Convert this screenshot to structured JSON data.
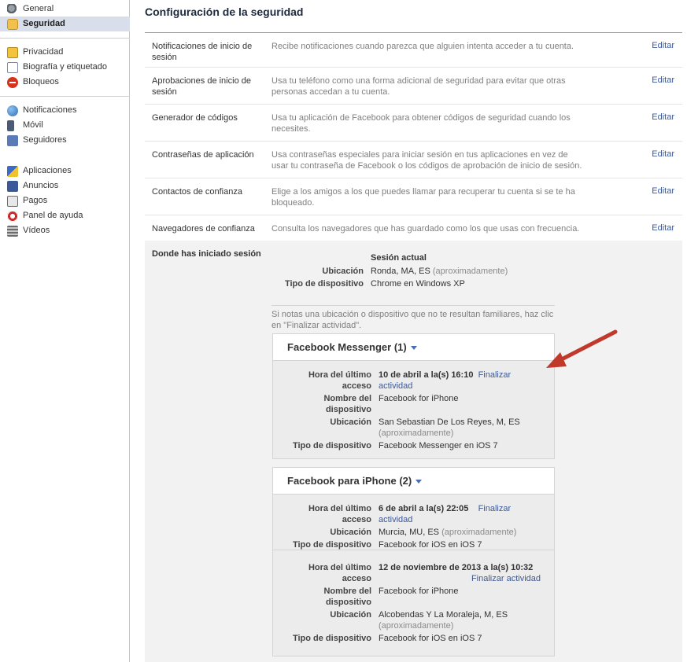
{
  "sidebar": {
    "groups": [
      [
        {
          "label": "General",
          "icon": "general-gears-icon"
        },
        {
          "label": "Seguridad",
          "icon": "security-badge-icon",
          "active": true
        }
      ],
      [
        {
          "label": "Privacidad",
          "icon": "privacy-lock-icon"
        },
        {
          "label": "Biografía y etiquetado",
          "icon": "timeline-icon"
        },
        {
          "label": "Bloqueos",
          "icon": "block-icon"
        }
      ],
      [
        {
          "label": "Notificaciones",
          "icon": "notifications-globe-icon"
        },
        {
          "label": "Móvil",
          "icon": "mobile-phone-icon"
        },
        {
          "label": "Seguidores",
          "icon": "followers-rss-icon"
        }
      ],
      [
        {
          "label": "Aplicaciones",
          "icon": "apps-cube-icon"
        },
        {
          "label": "Anuncios",
          "icon": "ads-icon"
        },
        {
          "label": "Pagos",
          "icon": "payments-card-icon"
        },
        {
          "label": "Panel de ayuda",
          "icon": "help-lifebuoy-icon"
        },
        {
          "label": "Vídeos",
          "icon": "videos-film-icon"
        }
      ]
    ]
  },
  "main": {
    "title": "Configuración de la seguridad",
    "edit_label": "Editar",
    "settings": [
      {
        "label": "Notificaciones de inicio de sesión",
        "desc": "Recibe notificaciones cuando parezca que alguien intenta acceder a tu cuenta."
      },
      {
        "label": "Aprobaciones de inicio de sesión",
        "desc": "Usa tu teléfono como una forma adicional de seguridad para evitar que otras personas accedan a tu cuenta."
      },
      {
        "label": "Generador de códigos",
        "desc": "Usa tu aplicación de Facebook para obtener códigos de seguridad cuando los necesites."
      },
      {
        "label": "Contraseñas de aplicación",
        "desc": "Usa contraseñas especiales para iniciar sesión en tus aplicaciones en vez de usar tu contraseña de Facebook o los códigos de aprobación de inicio de sesión."
      },
      {
        "label": "Contactos de confianza",
        "desc": "Elige a los amigos a los que puedes llamar para recuperar tu cuenta si se te ha bloqueado."
      },
      {
        "label": "Navegadores de confianza",
        "desc": "Consulta los navegadores que has guardado como los que usas con frecuencia."
      }
    ],
    "sessions": {
      "label": "Donde has iniciado sesión",
      "current": {
        "heading": "Sesión actual",
        "location_key": "Ubicación",
        "location_value": "Ronda, MA, ES",
        "approx": "(aproximadamente)",
        "device_key": "Tipo de dispositivo",
        "device_value": "Chrome en Windows XP"
      },
      "hint": "Si notas una ubicación o dispositivo que no te resultan familiares, haz clic en \"Finalizar actividad\".",
      "end_activity": "Finalizar actividad",
      "keys": {
        "last_access": "Hora del último acceso",
        "device_name": "Nombre del dispositivo",
        "location": "Ubicación",
        "device_type": "Tipo de dispositivo"
      },
      "approx": "(aproximadamente)",
      "messenger": {
        "title": "Facebook Messenger (1)",
        "time": "10 de abril a la(s) 16:10",
        "device_name": "Facebook for iPhone",
        "location": "San Sebastian De Los Reyes, M, ES",
        "device_type": "Facebook Messenger en iOS 7"
      },
      "iphone": {
        "title": "Facebook para iPhone (2)",
        "e1": {
          "time": "6 de abril a la(s) 22:05",
          "location": "Murcia, MU, ES",
          "device_type": "Facebook for iOS en iOS 7"
        },
        "e2": {
          "time": "12 de noviembre de 2013 a la(s) 10:32",
          "device_name": "Facebook for iPhone",
          "location": "Alcobendas Y La Moraleja, M, ES",
          "device_type": "Facebook for iOS en iOS 7"
        }
      }
    }
  },
  "colors": {
    "accent": "#3b5998",
    "annotation_arrow": "#c0392b"
  }
}
